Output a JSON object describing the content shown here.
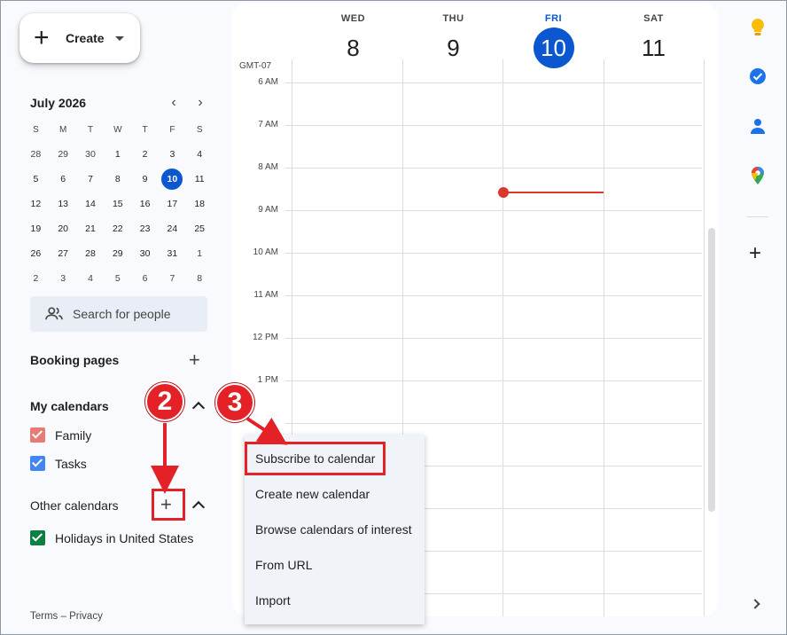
{
  "create": {
    "label": "Create"
  },
  "mini_calendar": {
    "title": "July 2026",
    "dow": [
      "S",
      "M",
      "T",
      "W",
      "T",
      "F",
      "S"
    ],
    "weeks": [
      [
        "28",
        "29",
        "30",
        "1",
        "2",
        "3",
        "4"
      ],
      [
        "5",
        "6",
        "7",
        "8",
        "9",
        "10",
        "11"
      ],
      [
        "12",
        "13",
        "14",
        "15",
        "16",
        "17",
        "18"
      ],
      [
        "19",
        "20",
        "21",
        "22",
        "23",
        "24",
        "25"
      ],
      [
        "26",
        "27",
        "28",
        "29",
        "30",
        "31",
        "1"
      ],
      [
        "2",
        "3",
        "4",
        "5",
        "6",
        "7",
        "8"
      ]
    ],
    "today": "10"
  },
  "search_people": {
    "placeholder": "Search for people"
  },
  "booking": {
    "label": "Booking pages"
  },
  "my_calendars": {
    "label": "My calendars",
    "items": [
      {
        "name": "Family",
        "color": "#e67c73"
      },
      {
        "name": "Tasks",
        "color": "#4285f4"
      }
    ]
  },
  "other_calendars": {
    "label": "Other calendars",
    "items": [
      {
        "name": "Holidays in United States",
        "color": "#0b8043"
      }
    ]
  },
  "footer": {
    "terms": "Terms",
    "sep": "–",
    "privacy": "Privacy"
  },
  "week_view": {
    "timezone": "GMT-07",
    "days": [
      {
        "dow": "WED",
        "num": "8",
        "today": false
      },
      {
        "dow": "THU",
        "num": "9",
        "today": false
      },
      {
        "dow": "FRI",
        "num": "10",
        "today": true
      },
      {
        "dow": "SAT",
        "num": "11",
        "today": false
      }
    ],
    "hours": [
      "6 AM",
      "7 AM",
      "8 AM",
      "9 AM",
      "10 AM",
      "11 AM",
      "12 PM",
      "1 PM"
    ]
  },
  "menu": {
    "items": [
      "Subscribe to calendar",
      "Create new calendar",
      "Browse calendars of interest",
      "From URL",
      "Import"
    ]
  },
  "annotations": {
    "step2": "2",
    "step3": "3"
  },
  "colors": {
    "accent": "#0b57d0",
    "annotation": "#e32127",
    "now_line": "#db372d"
  }
}
